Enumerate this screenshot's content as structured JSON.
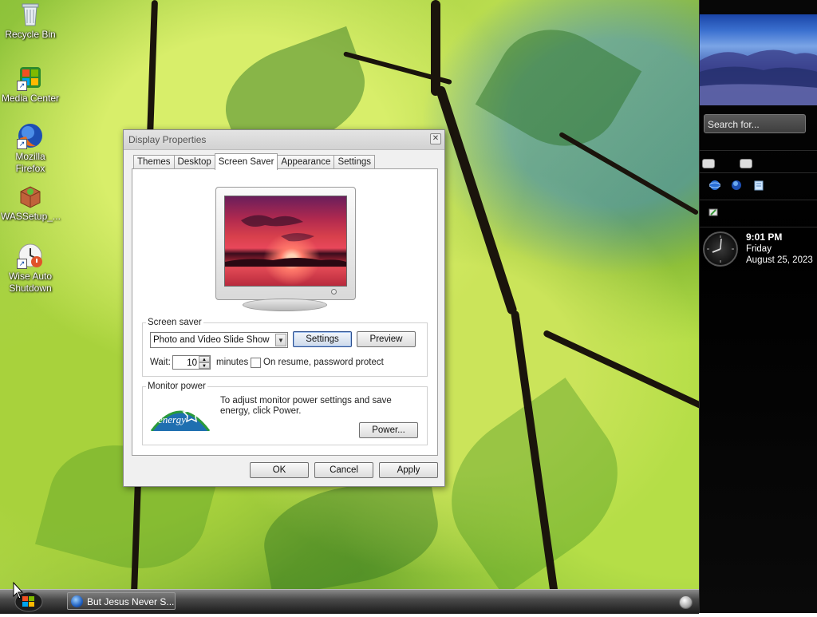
{
  "desktop": {
    "icons": [
      {
        "label": "Recycle Bin",
        "icon": "recycle-bin-icon"
      },
      {
        "label": "Media Center",
        "icon": "media-center-icon"
      },
      {
        "label": "Mozilla Firefox",
        "icon": "firefox-icon"
      },
      {
        "label": "WASSetup_...",
        "icon": "package-icon"
      },
      {
        "label": "Wise Auto Shutdown",
        "icon": "shutdown-icon"
      }
    ]
  },
  "dialog": {
    "title": "Display Properties",
    "tabs": [
      "Themes",
      "Desktop",
      "Screen Saver",
      "Appearance",
      "Settings"
    ],
    "active_tab": "Screen Saver",
    "screen_saver": {
      "group_label": "Screen saver",
      "selected": "Photo and Video Slide Show",
      "settings_label": "Settings",
      "preview_label": "Preview",
      "wait_label": "Wait:",
      "wait_value": "10",
      "minutes_label": "minutes",
      "password_label": "On resume, password protect",
      "password_checked": false
    },
    "monitor_power": {
      "group_label": "Monitor power",
      "description": "To adjust monitor power settings and save energy, click Power.",
      "power_label": "Power...",
      "logo_text": "energy"
    },
    "buttons": {
      "ok": "OK",
      "cancel": "Cancel",
      "apply": "Apply"
    }
  },
  "taskbar": {
    "task_item": "But Jesus Never S..."
  },
  "sidebar": {
    "search_placeholder": "Search for...",
    "clock": {
      "time": "9:01 PM",
      "day": "Friday",
      "date": "August 25, 2023"
    }
  }
}
